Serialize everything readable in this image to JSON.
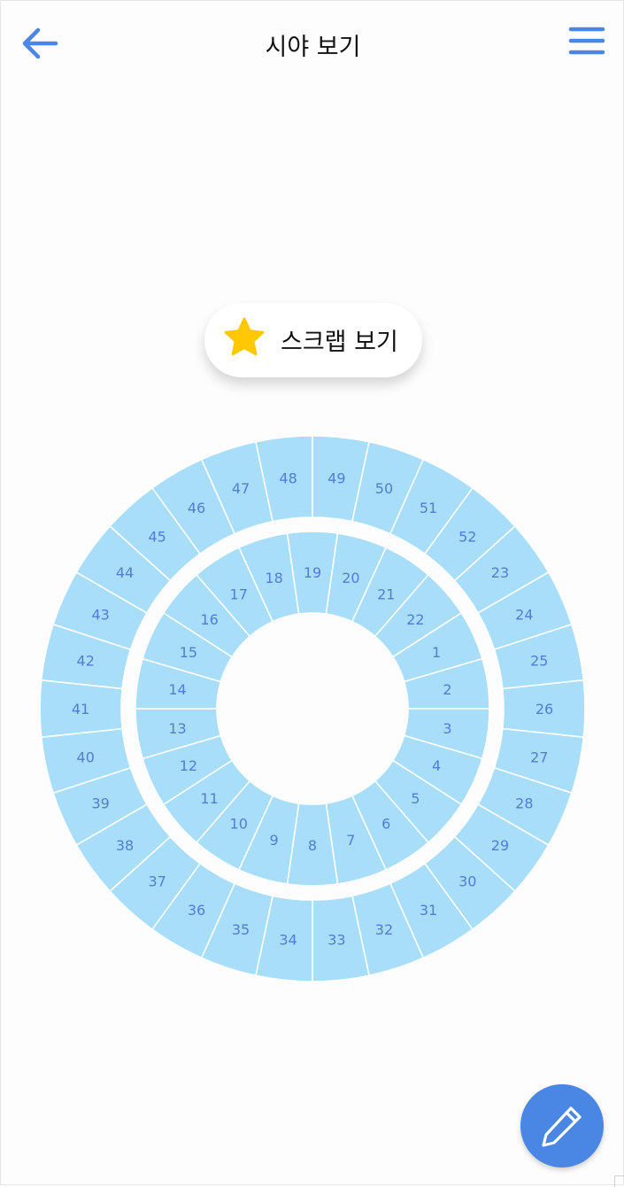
{
  "header": {
    "title": "시야 보기",
    "back_icon": "arrow-left-icon",
    "menu_icon": "hamburger-menu-icon"
  },
  "scrap_button": {
    "label": "스크랩 보기",
    "icon": "star-icon"
  },
  "seat_map": {
    "inner_ring": [
      "1",
      "2",
      "3",
      "4",
      "5",
      "6",
      "7",
      "8",
      "9",
      "10",
      "11",
      "12",
      "13",
      "14",
      "15",
      "16",
      "17",
      "18",
      "19",
      "20",
      "21",
      "22"
    ],
    "outer_ring": [
      "23",
      "24",
      "25",
      "26",
      "27",
      "28",
      "29",
      "30",
      "31",
      "32",
      "33",
      "34",
      "35",
      "36",
      "37",
      "38",
      "39",
      "40",
      "41",
      "42",
      "43",
      "44",
      "45",
      "46",
      "47",
      "48",
      "49",
      "50",
      "51",
      "52"
    ]
  },
  "fab": {
    "icon": "pencil-icon"
  },
  "colors": {
    "accent": "#4a87e4",
    "seat_fill": "#a8defa",
    "seat_text": "#4f7fd4",
    "star": "#ffc800"
  }
}
